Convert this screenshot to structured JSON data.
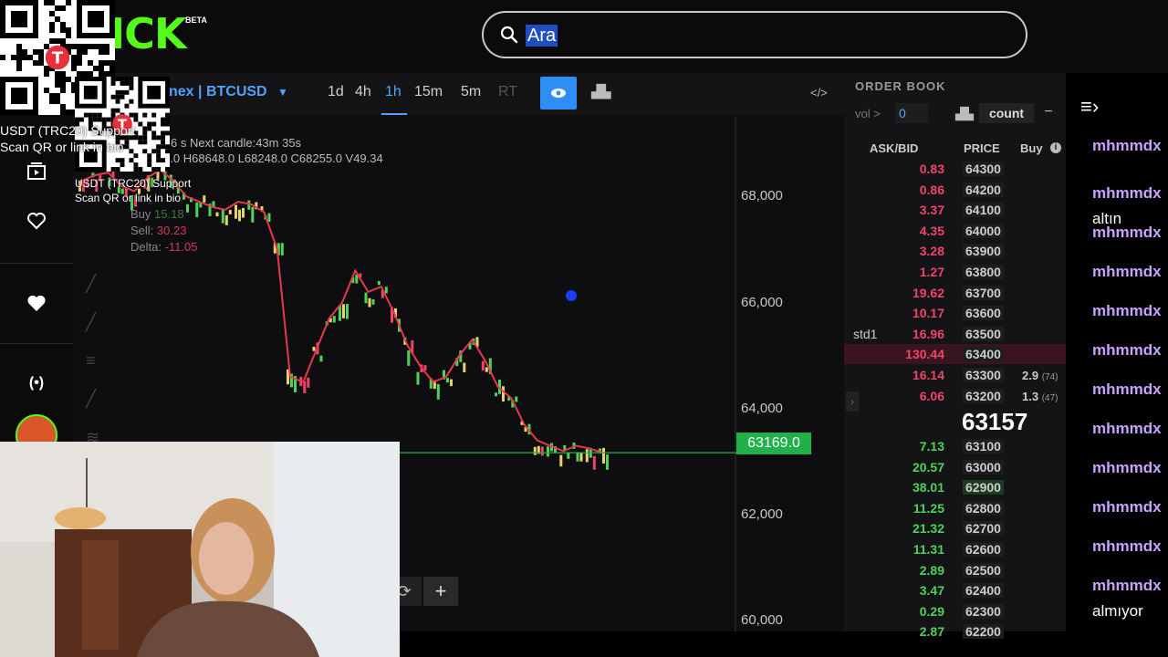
{
  "header": {
    "logo_text": "ICK",
    "logo_badge": "BETA",
    "search_value": "Ara"
  },
  "overlay": {
    "qr_caption_1": "USDT (TRC20) Support",
    "qr_caption_2": "Scan QR or link in bio",
    "qr_caption_small_1": "USDT (TRC20) Support",
    "qr_caption_small_2": "Scan QR or link in bio"
  },
  "chart": {
    "market": "nex | BTCUSD",
    "timeframes": [
      "1d",
      "4h",
      "1h",
      "15m",
      "5m",
      "RT"
    ],
    "info_line_1": "pdate:1.6 s   Next candle:43m 35s",
    "info_line_2": "O68593.0 H68648.0 L68248.0 C68255.0 V49.34",
    "buy_label": "Buy",
    "buy_value": "15.18",
    "sell_label": "Sell:",
    "sell_value": "30.23",
    "delta_label": "Delta:",
    "delta_value": "-11.05",
    "price_tag": "63169.0",
    "colors": {
      "accent": "#2f8ef5",
      "up": "#4cd35a",
      "down": "#f0436a",
      "price_line": "#22b04a"
    }
  },
  "chart_data": {
    "type": "line",
    "title": "",
    "ylim": [
      59800,
      69500
    ],
    "y_ticks": [
      "68,000",
      "66,000",
      "64,000",
      "62,000",
      "60,000"
    ],
    "current_price": 63169.0,
    "series": [
      {
        "values": [
          68300,
          68400,
          68450,
          68200,
          68100,
          68350,
          68500,
          68300,
          68000,
          67900,
          67800,
          67750,
          67900,
          67850,
          67700,
          67000,
          64600,
          64500,
          65100,
          65700,
          66000,
          66600,
          66200,
          66300,
          65800,
          65200,
          64800,
          64500,
          64600,
          65000,
          65300,
          64900,
          64400,
          64200,
          63700,
          63400,
          63300,
          63200,
          63300,
          63250,
          63169
        ]
      }
    ]
  },
  "orderbook": {
    "title": "ORDER BOOK",
    "vol_label": "vol >",
    "vol_value": "0",
    "count_label": "count",
    "headers": {
      "askbid": "ASK/BID",
      "price": "PRICE",
      "buy": "Buy"
    },
    "asks": [
      {
        "amount": "0.83",
        "price": "64300"
      },
      {
        "amount": "0.86",
        "price": "64200"
      },
      {
        "amount": "3.37",
        "price": "64100"
      },
      {
        "amount": "4.35",
        "price": "64000"
      },
      {
        "amount": "3.28",
        "price": "63900"
      },
      {
        "amount": "1.27",
        "price": "63800"
      },
      {
        "amount": "19.62",
        "price": "63700"
      },
      {
        "amount": "10.17",
        "price": "63600"
      },
      {
        "amount": "16.96",
        "price": "63500",
        "tag": "std1"
      },
      {
        "amount": "130.44",
        "price": "63400"
      },
      {
        "amount": "16.14",
        "price": "63300",
        "buy": "2.9",
        "buy_count": "(74)"
      },
      {
        "amount": "6.06",
        "price": "63200",
        "buy": "1.3",
        "buy_count": "(47)"
      }
    ],
    "mid_price": "63157",
    "bids": [
      {
        "amount": "7.13",
        "price": "63100"
      },
      {
        "amount": "20.57",
        "price": "63000"
      },
      {
        "amount": "38.01",
        "price": "62900"
      },
      {
        "amount": "11.25",
        "price": "62800"
      },
      {
        "amount": "21.32",
        "price": "62700"
      },
      {
        "amount": "11.31",
        "price": "62600"
      },
      {
        "amount": "2.89",
        "price": "62500"
      },
      {
        "amount": "3.47",
        "price": "62400"
      },
      {
        "amount": "0.29",
        "price": "62300"
      },
      {
        "amount": "2.87",
        "price": "62200"
      }
    ]
  },
  "chat": {
    "messages": [
      {
        "user": "mhmmdx"
      },
      {
        "user": "mhmmdx",
        "text": "altın"
      },
      {
        "user": "mhmmdx"
      },
      {
        "user": "mhmmdx"
      },
      {
        "user": "mhmmdx"
      },
      {
        "user": "mhmmdx"
      },
      {
        "user": "mhmmdx"
      },
      {
        "user": "mhmmdx"
      },
      {
        "user": "mhmmdx"
      },
      {
        "user": "mhmmdx"
      },
      {
        "user": "mhmmdx"
      },
      {
        "user": "mhmmdx",
        "text": "almıyor"
      }
    ]
  }
}
